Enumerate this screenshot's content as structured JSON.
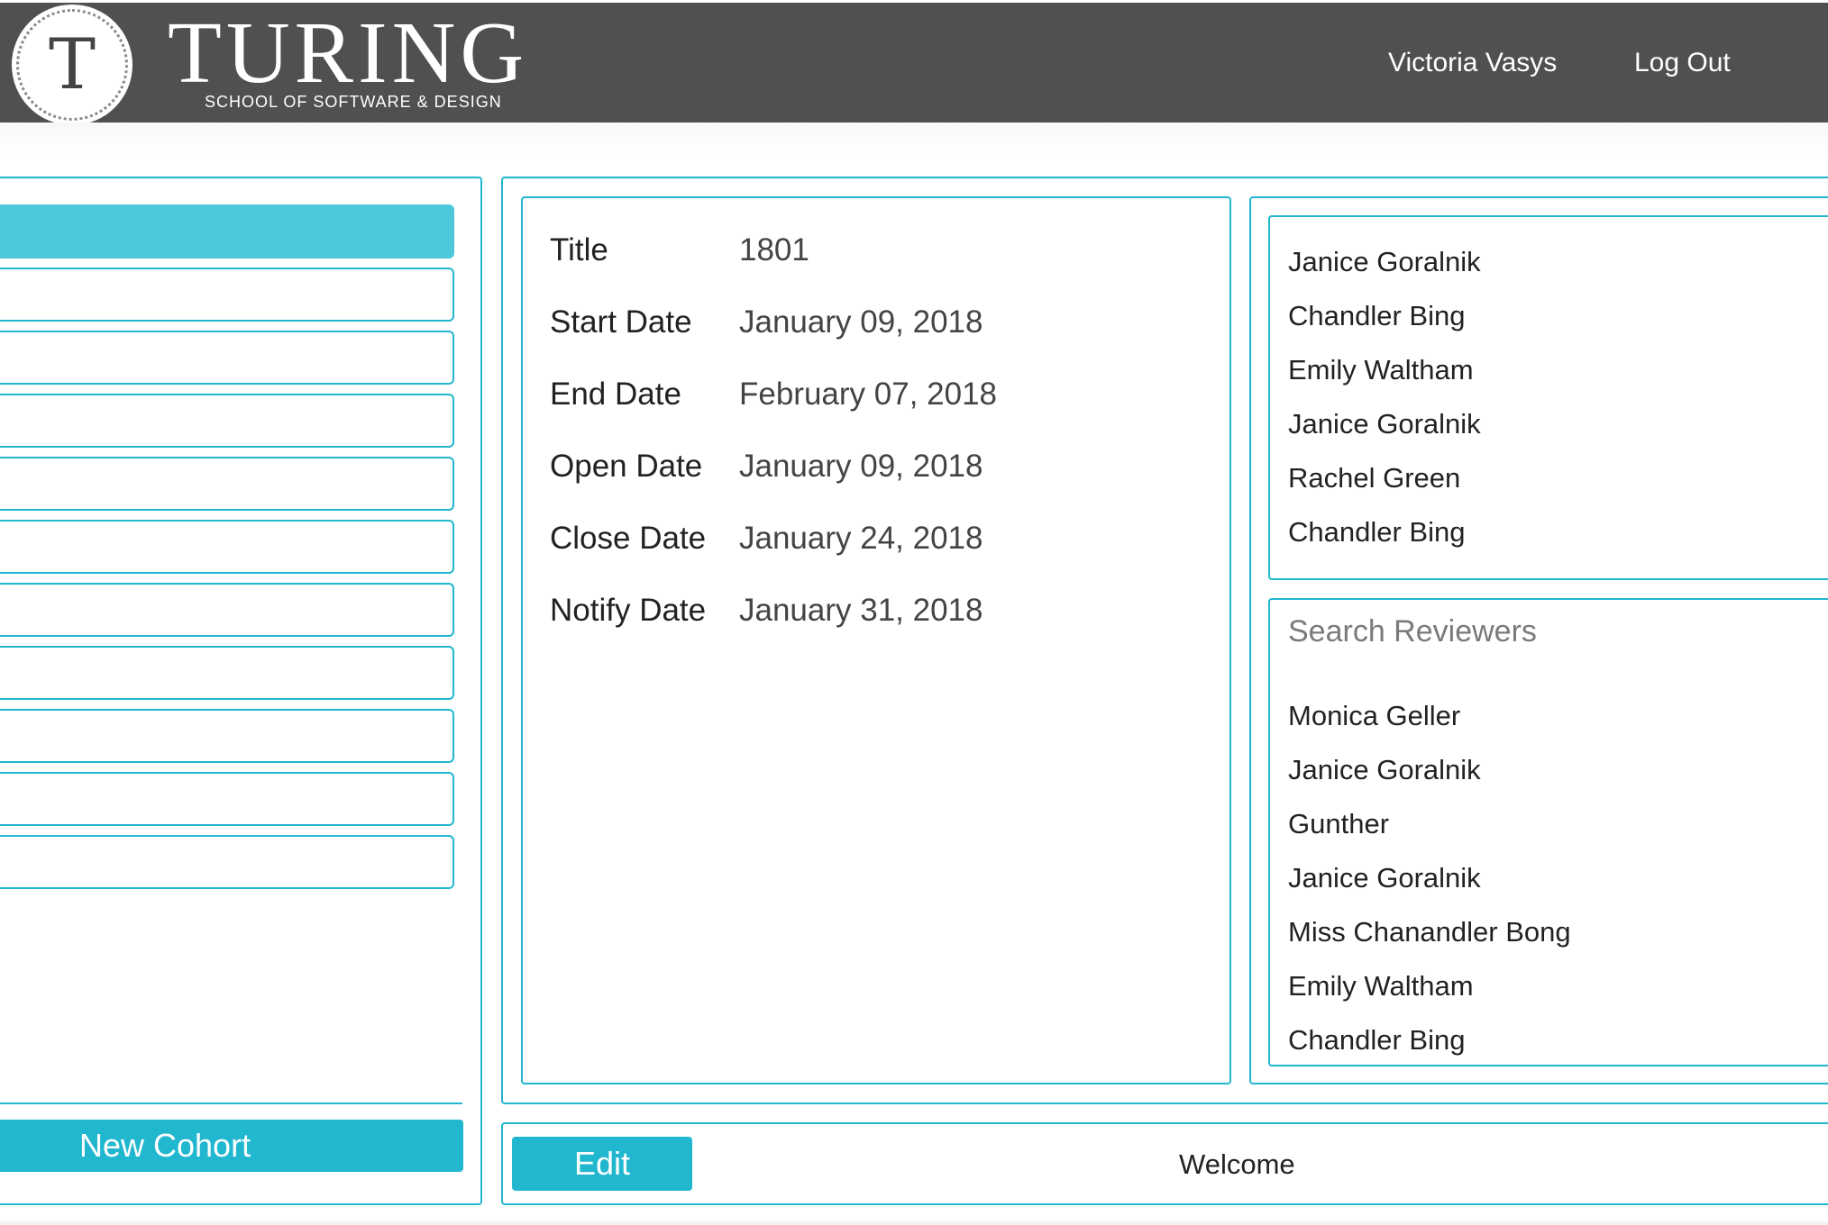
{
  "header": {
    "logo_letter": "T",
    "brand_name": "TURING",
    "brand_subtitle": "SCHOOL OF SOFTWARE & DESIGN",
    "user_name": "Victoria Vasys",
    "logout_label": "Log Out"
  },
  "sidebar": {
    "active_index": 0,
    "cohort_item_count": 11,
    "new_cohort_label": "New Cohort"
  },
  "details": {
    "rows": [
      {
        "label": "Title",
        "value": "1801"
      },
      {
        "label": "Start Date",
        "value": "January 09, 2018"
      },
      {
        "label": "End Date",
        "value": "February 07, 2018"
      },
      {
        "label": "Open Date",
        "value": "January 09, 2018"
      },
      {
        "label": "Close Date",
        "value": "January 24, 2018"
      },
      {
        "label": "Notify Date",
        "value": "January 31, 2018"
      }
    ]
  },
  "assigned_reviewers": [
    "Janice Goralnik",
    "Chandler Bing",
    "Emily Waltham",
    "Janice Goralnik",
    "Rachel Green",
    "Chandler Bing"
  ],
  "reviewer_search": {
    "placeholder": "Search Reviewers",
    "value": ""
  },
  "available_reviewers": [
    "Monica Geller",
    "Janice Goralnik",
    "Gunther",
    "Janice Goralnik",
    "Miss Chanandler Bong",
    "Emily Waltham",
    "Chandler Bing"
  ],
  "footer": {
    "edit_label": "Edit",
    "welcome_text": "Welcome"
  },
  "colors": {
    "accent": "#20b7cf",
    "active_item": "#4cc8da",
    "header_bg": "#505052"
  }
}
